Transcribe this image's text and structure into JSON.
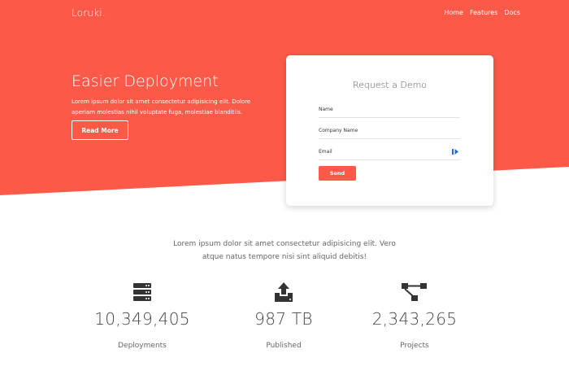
{
  "nav": {
    "brand": "Loruki.",
    "links": [
      "Home",
      "Features",
      "Docs"
    ]
  },
  "hero": {
    "title": "Easier Deployment",
    "text": "Lorem ipsum dolor sit amet consectetur adipisicing elit. Dolore aperiam molestias nihil voluptate fuga, molestiae blanditiis.",
    "button": "Read More"
  },
  "demo": {
    "title": "Request a Demo",
    "fields": [
      "Name",
      "Company Name",
      "Email"
    ],
    "email_icon": "autofill-icon",
    "send": "Send"
  },
  "intro": {
    "line1": "Lorem ipsum dolor sit amet consectetur adipisicing elit. Vero",
    "line2": "atque natus tempore nisi sint aliquid debitis!"
  },
  "stats": [
    {
      "icon": "server-icon",
      "value": "10,349,405",
      "label": "Deployments"
    },
    {
      "icon": "upload-icon",
      "value": "987 TB",
      "label": "Published"
    },
    {
      "icon": "project-diagram-icon",
      "value": "2,343,265",
      "label": "Projects"
    }
  ],
  "colors": {
    "accent": "#fc5a48",
    "text": "#333333"
  }
}
